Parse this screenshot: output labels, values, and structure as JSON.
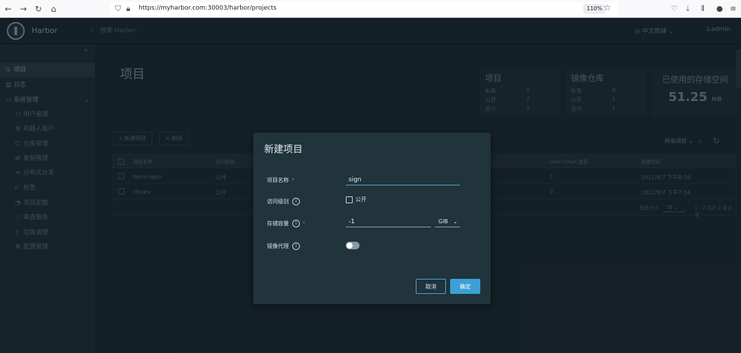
{
  "browser": {
    "url": "https://myharbor.com:30003/harbor/projects",
    "zoom": "110%",
    "icons": {
      "back": "arrow-left-icon",
      "forward": "arrow-right-icon",
      "reload": "reload-icon",
      "home": "home-icon",
      "shield": "shield-icon",
      "lock": "lock-icon",
      "star": "star-icon",
      "pocket": "pocket-icon",
      "download": "download-icon",
      "library": "library-icon",
      "account": "account-icon",
      "menu": "menu-icon"
    }
  },
  "header": {
    "brand": "Harbor",
    "search_placeholder": "搜索 Harbor...",
    "language": "中文简体",
    "user": "admin"
  },
  "sidebar": {
    "items": [
      {
        "label": "项目",
        "icon": "projects-icon"
      },
      {
        "label": "日志",
        "icon": "logs-icon"
      },
      {
        "label": "系统管理",
        "icon": "system-icon"
      },
      {
        "label": "用户管理",
        "icon": "users-icon"
      },
      {
        "label": "机器人账户",
        "icon": "robot-icon"
      },
      {
        "label": "仓库管理",
        "icon": "registry-icon"
      },
      {
        "label": "复制管理",
        "icon": "replication-icon"
      },
      {
        "label": "分布式分发",
        "icon": "distribution-icon"
      },
      {
        "label": "标签",
        "icon": "tag-icon"
      },
      {
        "label": "项目定额",
        "icon": "quota-icon"
      },
      {
        "label": "审查服务",
        "icon": "scanner-icon"
      },
      {
        "label": "垃圾清理",
        "icon": "trash-icon"
      },
      {
        "label": "配置管理",
        "icon": "settings-icon"
      }
    ]
  },
  "main": {
    "title": "项目",
    "stats_projects": {
      "title": "项目",
      "rows": [
        {
          "k": "私有",
          "v": "0"
        },
        {
          "k": "公开",
          "v": "2"
        },
        {
          "k": "总计",
          "v": "2"
        }
      ]
    },
    "stats_repos": {
      "title": "镜像仓库",
      "rows": [
        {
          "k": "私有",
          "v": "0"
        },
        {
          "k": "公开",
          "v": "1"
        },
        {
          "k": "总计",
          "v": "1"
        }
      ]
    },
    "storage": {
      "title": "已使用的存储空间",
      "value": "51.25",
      "unit": "MiB"
    },
    "new_project_label": "+ 新建项目",
    "delete_label": "✕ 删除",
    "filter_label": "所有项目",
    "table": {
      "headers": [
        "项目名称",
        "访问级别",
        "Helm Chart 数目",
        "创建时间"
      ],
      "rows": [
        {
          "name": "helm-repo",
          "access": "公开",
          "charts": "2",
          "created": "2021/8/7 下午8:06"
        },
        {
          "name": "library",
          "access": "公开",
          "charts": "0",
          "created": "2021/8/7 下午7:54"
        }
      ],
      "page_size_label": "页面大小",
      "page_size": "15",
      "total": "1 - 2 共计 2 条记录"
    }
  },
  "modal": {
    "title": "新建项目",
    "name_label": "项目名称",
    "name_value": "sign",
    "access_label": "访问级别",
    "public_label": "公开",
    "storage_label": "存储容量",
    "storage_value": "-1",
    "storage_unit": "GiB",
    "proxy_label": "镜像代理",
    "cancel_label": "取消",
    "ok_label": "确定",
    "required_mark": "*",
    "info_glyph": "i"
  }
}
